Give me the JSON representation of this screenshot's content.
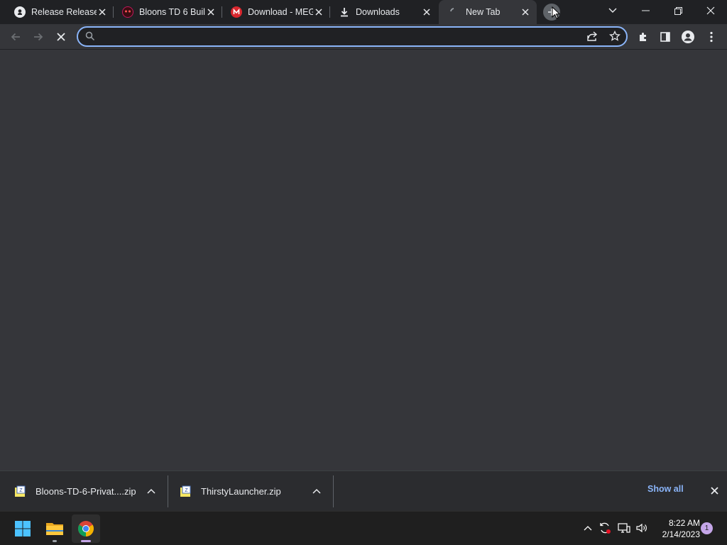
{
  "tabs": [
    {
      "title": "Release Release",
      "favicon": "github-icon"
    },
    {
      "title": "Bloons TD 6 Buil",
      "favicon": "bloons-icon"
    },
    {
      "title": "Download - MEG",
      "favicon": "mega-icon"
    },
    {
      "title": "Downloads",
      "favicon": "download-icon"
    },
    {
      "title": "New Tab",
      "favicon": "loading-spinner-icon",
      "active": true
    }
  ],
  "omnibox": {
    "value": "",
    "placeholder": ""
  },
  "downloads": [
    {
      "filename": "Bloons-TD-6-Privat....zip",
      "icon": "zip-file-icon"
    },
    {
      "filename": "ThirstyLauncher.zip",
      "icon": "zip-file-icon"
    }
  ],
  "shelf": {
    "show_all_label": "Show all"
  },
  "taskbar": {
    "apps": [
      "windows-start-icon",
      "file-explorer-icon",
      "chrome-icon"
    ],
    "time": "8:22 AM",
    "date": "2/14/2023",
    "notification_count": "1"
  },
  "colors": {
    "accent": "#8ab4f8",
    "background": "#35363a",
    "tabstrip": "#202124"
  }
}
